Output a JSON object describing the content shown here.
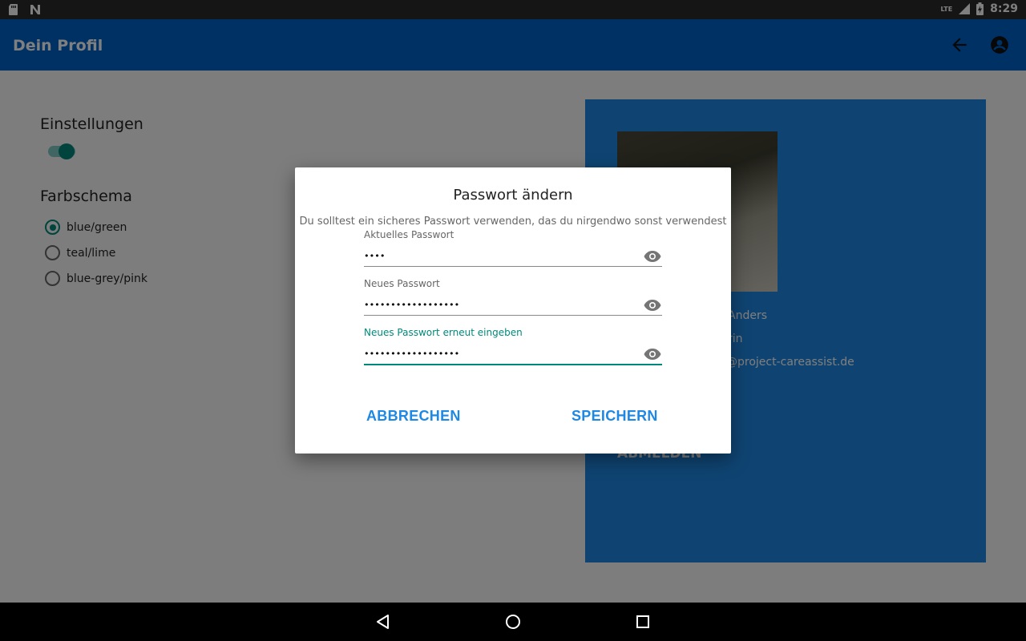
{
  "statusbar": {
    "time": "8:29",
    "network": "LTE"
  },
  "appbar": {
    "title": "Dein Profil"
  },
  "settings": {
    "heading": "Einstellungen",
    "toggle_on": true,
    "color_scheme_heading": "Farbschema",
    "schemes": [
      {
        "label": "blue/green",
        "selected": true
      },
      {
        "label": "teal/lime",
        "selected": false
      },
      {
        "label": "blue-grey/pink",
        "selected": false
      }
    ]
  },
  "profile": {
    "name_fragment": "Anders",
    "role_fragment": "rin",
    "email_fragment": "@project-careassist.de",
    "logout_label": "ABMELDEN"
  },
  "dialog": {
    "title": "Passwort ändern",
    "subtitle": "Du solltest ein sicheres Passwort verwenden, das du nirgendwo sonst verwendest",
    "fields": [
      {
        "label": "Aktuelles Passwort",
        "value": "••••"
      },
      {
        "label": "Neues Passwort",
        "value": "••••••••••••••••••"
      },
      {
        "label": "Neues Passwort erneut eingeben",
        "value": "••••••••••••••••••"
      }
    ],
    "cancel_label": "ABBRECHEN",
    "save_label": "SPEICHERN"
  },
  "colors": {
    "appbar": "#0062c8",
    "accent": "#00897b",
    "panel": "#1e88e5",
    "button": "#1e88e5"
  }
}
